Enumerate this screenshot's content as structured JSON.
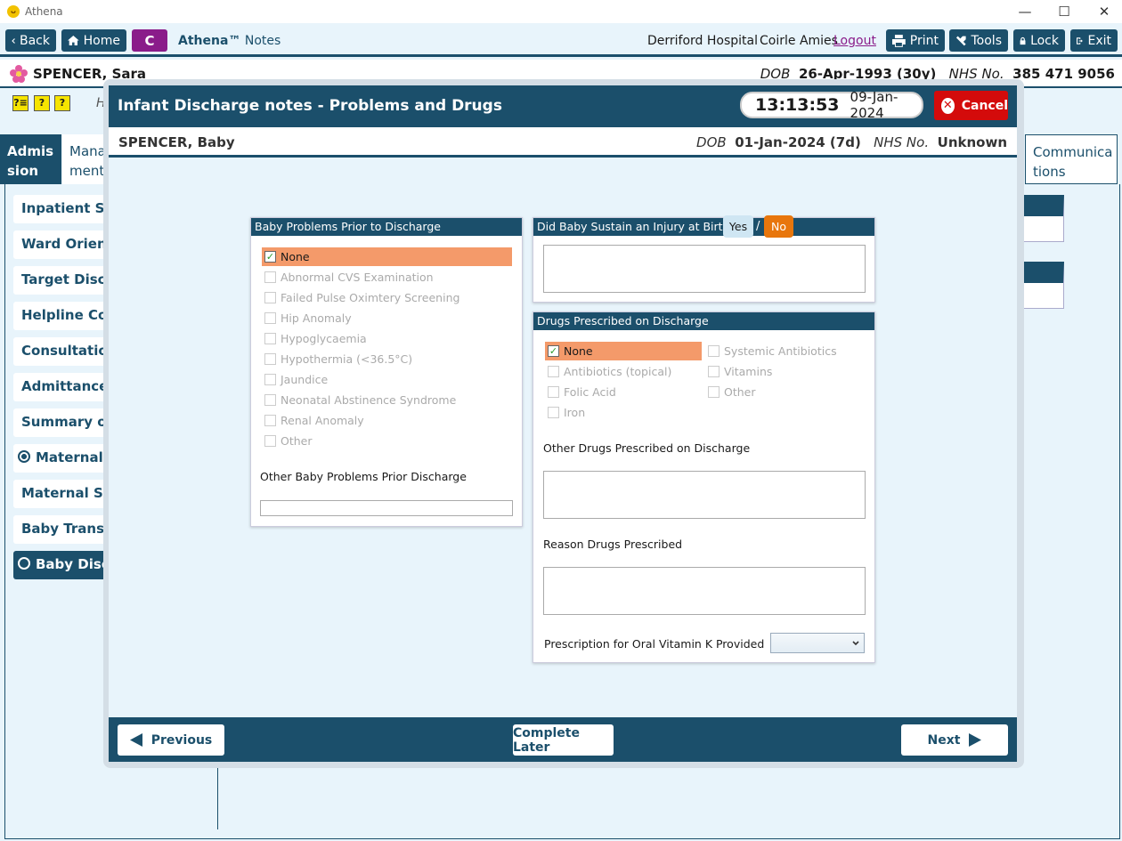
{
  "window": {
    "title": "Athena",
    "controls": [
      "—",
      "☐",
      "✕"
    ]
  },
  "toolbar": {
    "back": "Back",
    "home": "Home",
    "c_badge": "C",
    "app_name": "Athena™",
    "app_sub": "Notes",
    "hospital": "Derriford Hospital",
    "user": "Coirle Amies",
    "logout": "Logout",
    "print": "Print",
    "tools": "Tools",
    "lock": "Lock",
    "exit": "Exit"
  },
  "patient": {
    "name": "SPENCER, Sara",
    "dob_label": "DOB",
    "dob": "26-Apr-1993 (30y)",
    "nhs_label": "NHS No.",
    "nhs": "385 471 9056"
  },
  "background": {
    "help_icons": [
      "?≡",
      "?",
      "?"
    ],
    "hint": "H",
    "tabs": [
      "Admis\nsion",
      "Mana\nment",
      "Communica\ntions"
    ],
    "sidebar": [
      "Inpatient Stay",
      "Ward Orientat",
      "Target Dischar",
      "Helpline Cont",
      "Consultation I",
      "Admittance N",
      "Summary of P",
      "Maternal Di",
      "Maternal Self",
      "Baby Transfer",
      "Baby Discha"
    ]
  },
  "modal": {
    "title": "Infant Discharge notes - Problems and Drugs",
    "time": "13:13:53",
    "date": "09-Jan-2024",
    "cancel": "Cancel",
    "baby": {
      "name": "SPENCER, Baby",
      "dob_label": "DOB",
      "dob": "01-Jan-2024 (7d)",
      "nhs_label": "NHS No.",
      "nhs": "Unknown"
    },
    "problems": {
      "title": "Baby Problems Prior to Discharge",
      "options": [
        {
          "label": "None",
          "checked": true
        },
        {
          "label": "Abnormal CVS Examination",
          "checked": false
        },
        {
          "label": "Failed Pulse Oximtery Screening",
          "checked": false
        },
        {
          "label": "Hip Anomaly",
          "checked": false
        },
        {
          "label": "Hypoglycaemia",
          "checked": false
        },
        {
          "label": "Hypothermia (<36.5°C)",
          "checked": false
        },
        {
          "label": "Jaundice",
          "checked": false
        },
        {
          "label": "Neonatal Abstinence Syndrome",
          "checked": false
        },
        {
          "label": "Renal Anomaly",
          "checked": false
        },
        {
          "label": "Other",
          "checked": false
        }
      ],
      "other_label": "Other Baby Problems Prior Discharge",
      "other_value": ""
    },
    "injury": {
      "title": "Did Baby Sustain an Injury at Birth",
      "yes": "Yes",
      "sep": "/",
      "no": "No",
      "selected": "No",
      "value": ""
    },
    "drugs": {
      "title": "Drugs Prescribed on Discharge",
      "options": [
        {
          "label": "None",
          "checked": true
        },
        {
          "label": "Systemic Antibiotics",
          "checked": false
        },
        {
          "label": "Antibiotics (topical)",
          "checked": false
        },
        {
          "label": "Vitamins",
          "checked": false
        },
        {
          "label": "Folic Acid",
          "checked": false
        },
        {
          "label": "Other",
          "checked": false
        },
        {
          "label": "Iron",
          "checked": false
        }
      ],
      "other_label": "Other Drugs Prescribed on Discharge",
      "other_value": "",
      "reason_label": "Reason Drugs Prescribed",
      "reason_value": "",
      "vitk_label": "Prescription for Oral Vitamin K Provided",
      "vitk_value": ""
    },
    "footer": {
      "previous": "Previous",
      "complete_later": "Complete Later",
      "next": "Next"
    }
  },
  "colors": {
    "primary": "#1b4f6b",
    "selected": "#f49a6a",
    "no_active": "#e8760c",
    "cancel": "#d40b0b",
    "brand_c": "#8a1c8a"
  }
}
